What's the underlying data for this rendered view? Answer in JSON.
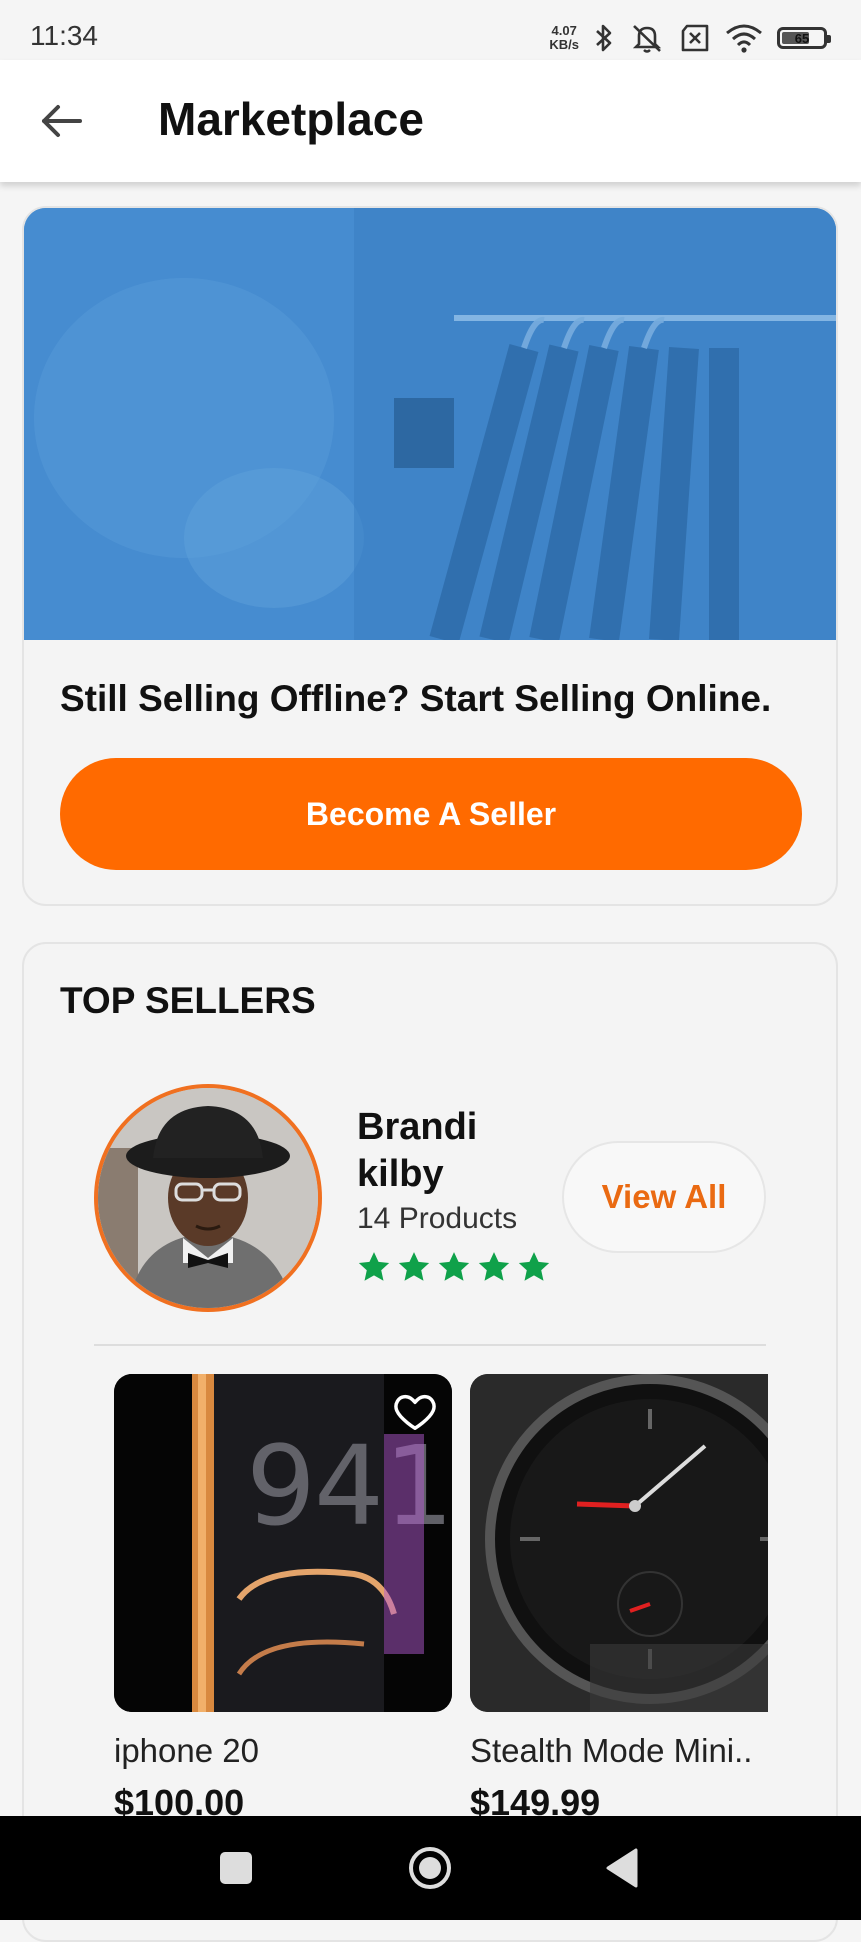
{
  "status_bar": {
    "time": "11:34",
    "net_speed_value": "4.07",
    "net_speed_unit": "KB/s",
    "battery_level": "65",
    "icons": [
      "bluetooth-icon",
      "mute-icon",
      "no-sim-icon",
      "wifi-icon",
      "battery-icon"
    ]
  },
  "app_bar": {
    "title": "Marketplace",
    "back_icon": "arrow-left-icon"
  },
  "banner": {
    "image": "clothing-rack-photo",
    "headline": "Still Selling Offline? Start Selling Online.",
    "cta_label": "Become A Seller",
    "cta_color": "#ff6a00",
    "tint_color": "#3d84c9"
  },
  "top_sellers": {
    "title": "TOP SELLERS",
    "seller": {
      "name": "Brandi kilby",
      "products": "14 Products",
      "rating": 5,
      "rating_max": 5,
      "star_color": "#0fa14a",
      "avatar_ring_color": "#f07020"
    },
    "view_all_label": "View All",
    "view_all_color": "#ea6a12",
    "products": [
      {
        "name": "iphone 20",
        "price": "$100.00",
        "image": "phone-photo"
      },
      {
        "name": "Stealth Mode Mini..",
        "price": "$149.99",
        "image": "watch-photo"
      }
    ]
  },
  "nav_bar": {
    "buttons": [
      "recents-square-icon",
      "home-circle-icon",
      "back-triangle-icon"
    ]
  }
}
